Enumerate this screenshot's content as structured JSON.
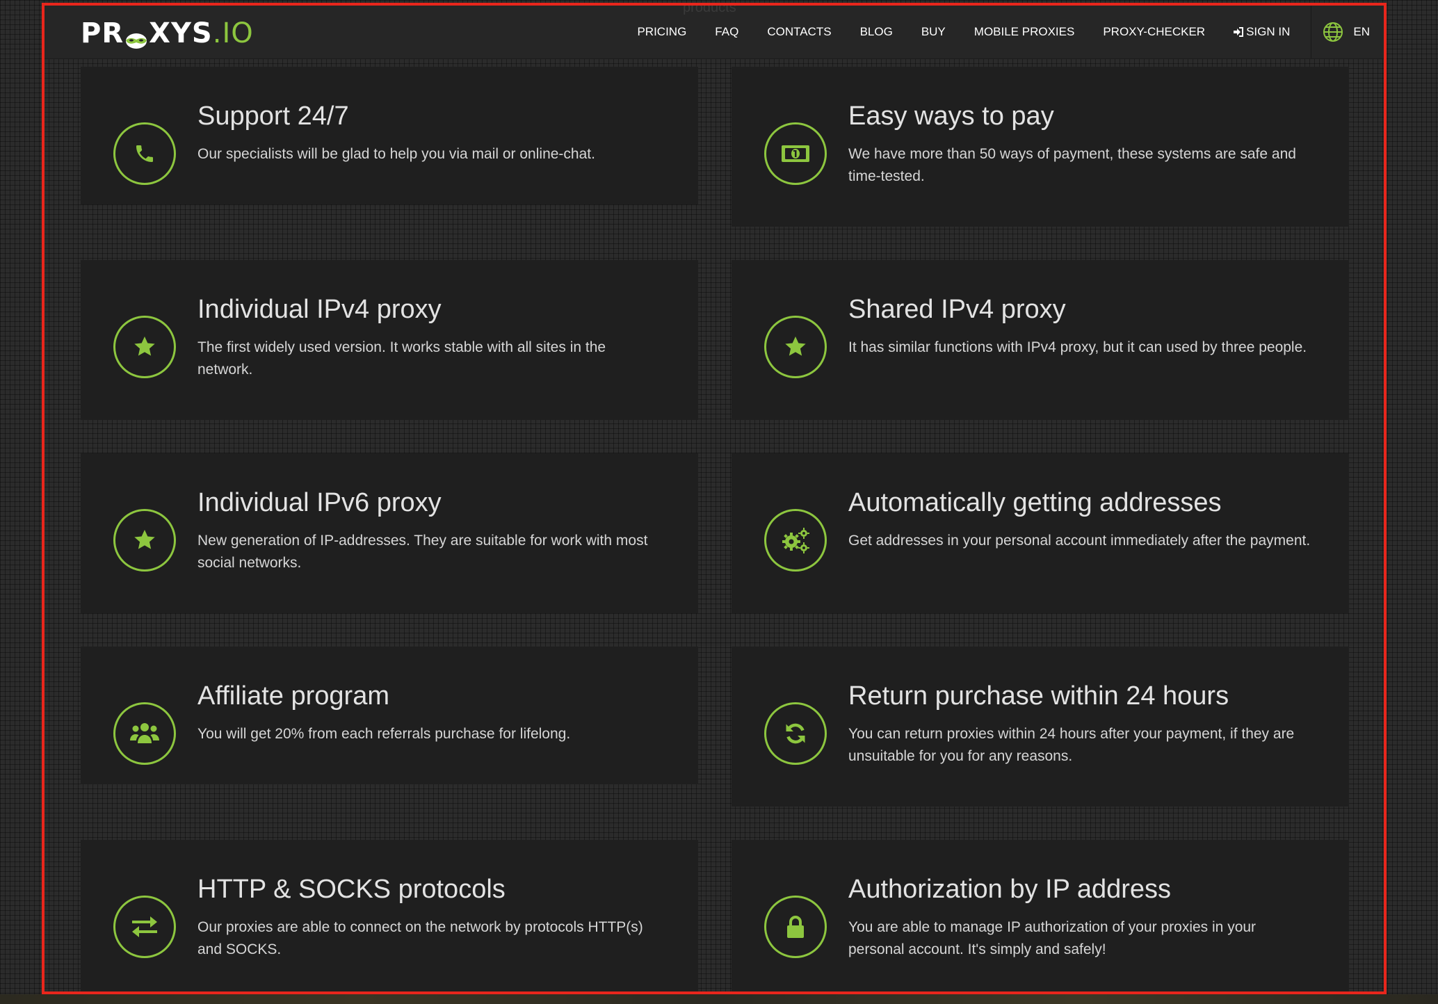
{
  "header": {
    "logo_main": "PR",
    "logo_main_2": "XYS",
    "logo_suffix": ".IO",
    "faded_label": "products",
    "nav": [
      {
        "label": "PRICING"
      },
      {
        "label": "FAQ"
      },
      {
        "label": "CONTACTS"
      },
      {
        "label": "BLOG"
      },
      {
        "label": "BUY"
      },
      {
        "label": "MOBILE PROXIES"
      },
      {
        "label": "PROXY-CHECKER"
      },
      {
        "label": "SIGN IN"
      }
    ],
    "language": "EN"
  },
  "colors": {
    "accent": "#8dc63f",
    "frame": "#e8261c",
    "card_bg": "#1f1f1f",
    "header_bg": "#262626"
  },
  "features": [
    {
      "title": "Support 24/7",
      "text": "Our specialists will be glad to help you via mail or online-chat.",
      "icon": "phone-icon"
    },
    {
      "title": "Easy ways to pay",
      "text": "We have more than 50 ways of payment, these systems are safe and time-tested.",
      "icon": "money-icon"
    },
    {
      "title": "Individual IPv4 proxy",
      "text": "The first widely used version. It works stable with all sites in the network.",
      "icon": "star-icon"
    },
    {
      "title": "Shared IPv4 proxy",
      "text": "It has similar functions with IPv4 proxy, but it can used by three people.",
      "icon": "star-icon"
    },
    {
      "title": "Individual IPv6 proxy",
      "text": "New generation of IP-addresses. They are suitable for work with most social networks.",
      "icon": "star-icon"
    },
    {
      "title": "Automatically getting addresses",
      "text": "Get addresses in your personal account immediately after the payment.",
      "icon": "gears-icon"
    },
    {
      "title": "Affiliate program",
      "text": "You will get 20% from each referrals purchase for lifelong.",
      "icon": "users-icon"
    },
    {
      "title": "Return purchase within 24 hours",
      "text": "You can return proxies within 24 hours after your payment, if they are unsuitable for you for any reasons.",
      "icon": "refresh-icon"
    },
    {
      "title": "HTTP & SOCKS protocols",
      "text": "Our proxies are able to connect on the network by protocols HTTP(s) and SOCKS.",
      "icon": "exchange-icon"
    },
    {
      "title": "Authorization by IP address",
      "text": "You are able to manage IP authorization of your proxies in your personal account. It's simply and safely!",
      "icon": "lock-icon"
    }
  ]
}
